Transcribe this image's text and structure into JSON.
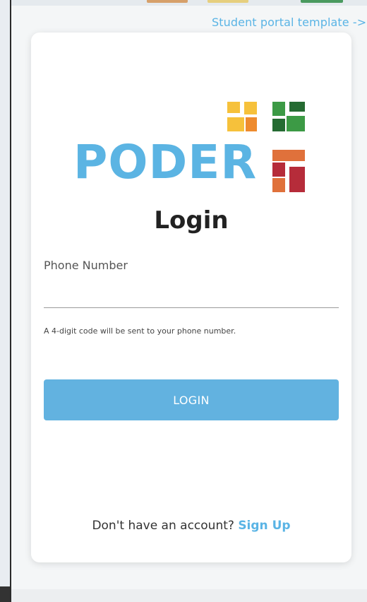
{
  "header": {
    "portal_link": "Student portal template ->"
  },
  "brand": {
    "logo_text": "PODER",
    "logo_colors": [
      "#5bb4e3",
      "#f6c13b",
      "#ee8b2e",
      "#3c9a45",
      "#256b32",
      "#e0713b",
      "#b62c3a"
    ]
  },
  "login": {
    "title": "Login",
    "phone_label": "Phone Number",
    "phone_value": "",
    "phone_placeholder": "",
    "helper_text": "A 4-digit code will be sent to your phone number.",
    "button_label": "LOGIN",
    "signup_prompt": "Don't have an account?",
    "signup_link": "Sign Up"
  },
  "colors": {
    "accent": "#5ab4e5",
    "button": "#62b2e0"
  }
}
